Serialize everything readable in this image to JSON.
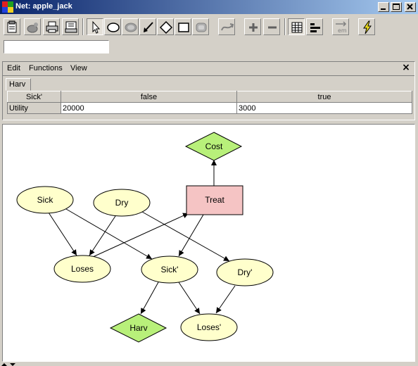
{
  "window": {
    "title": "Net: apple_jack"
  },
  "toolbar": {
    "buttons": [
      {
        "icon": "properties-icon"
      },
      {
        "icon": "compile-icon"
      },
      {
        "icon": "print-icon"
      },
      {
        "icon": "print-preview-icon"
      },
      {
        "icon": "select-arrow-icon"
      },
      {
        "icon": "chance-node-icon"
      },
      {
        "icon": "discrete-chance-node-icon"
      },
      {
        "icon": "arc-tool-icon"
      },
      {
        "icon": "decision-node-icon"
      },
      {
        "icon": "utility-node-icon"
      },
      {
        "icon": "instance-node-icon"
      },
      {
        "icon": "retract-icon"
      },
      {
        "icon": "zoom-in-icon"
      },
      {
        "icon": "zoom-out-icon"
      },
      {
        "icon": "table-view-icon"
      },
      {
        "icon": "node-list-icon"
      },
      {
        "icon": "em-learning-icon"
      },
      {
        "icon": "run-mode-icon"
      }
    ],
    "search_value": ""
  },
  "table_panel": {
    "menu": [
      "Edit",
      "Functions",
      "View"
    ],
    "close_label": "×",
    "tab": "Harv",
    "header": [
      "Sick'",
      "false",
      "true"
    ],
    "row": [
      "Utility",
      "20000",
      "3000"
    ]
  },
  "canvas": {
    "nodes": {
      "cost": "Cost",
      "treat": "Treat",
      "sick": "Sick",
      "dry": "Dry",
      "loses": "Loses",
      "sick2": "Sick'",
      "dry2": "Dry'",
      "harv": "Harv",
      "loses2": "Loses'"
    },
    "colors": {
      "chance_fill": "#ffffcc",
      "decision_fill": "#f5c4c4",
      "utility_fill": "#b8f07a"
    }
  }
}
